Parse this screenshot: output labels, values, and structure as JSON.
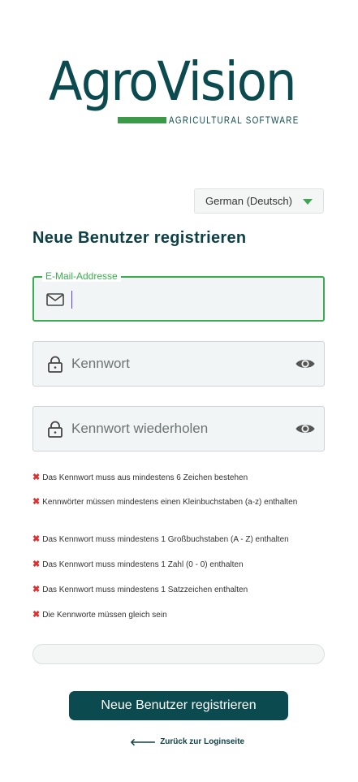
{
  "logo": {
    "name": "AgroVision",
    "tagline": "AGRICULTURAL SOFTWARE",
    "brand_color": "#0b4a4f",
    "accent_color": "#3a9a47"
  },
  "language": {
    "selected": "German (Deutsch)"
  },
  "page": {
    "title": "Neue Benutzer registrieren"
  },
  "form": {
    "email": {
      "label": "E-Mail-Addresse",
      "value": "",
      "icon": "mail-icon"
    },
    "password": {
      "placeholder": "Kennwort",
      "icon": "lock-icon",
      "toggle_icon": "eye-icon"
    },
    "password_repeat": {
      "placeholder": "Kennwort wiederholen",
      "icon": "lock-icon",
      "toggle_icon": "eye-icon"
    }
  },
  "rules": [
    "Das Kennwort muss aus mindestens 6 Zeichen bestehen",
    "Kennwörter müssen mindestens einen Kleinbuchstaben (a-z) enthalten",
    "Das Kennwort muss mindestens 1 Großbuchstaben (A - Z) enthalten",
    "Das Kennwort muss mindestens 1 Zahl (0 - 0) enthalten",
    "Das Kennwort muss mindestens 1 Satzzeichen enthalten",
    "Die Kennworte müssen gleich sein"
  ],
  "rule_status_icon": "x-icon",
  "password_strength": 0,
  "actions": {
    "submit_label": "Neue Benutzer registrieren",
    "back_label": "Zurück zur Loginseite"
  },
  "colors": {
    "error": "#e03131",
    "focus": "#3aae4f",
    "button": "#0b4a4f"
  }
}
